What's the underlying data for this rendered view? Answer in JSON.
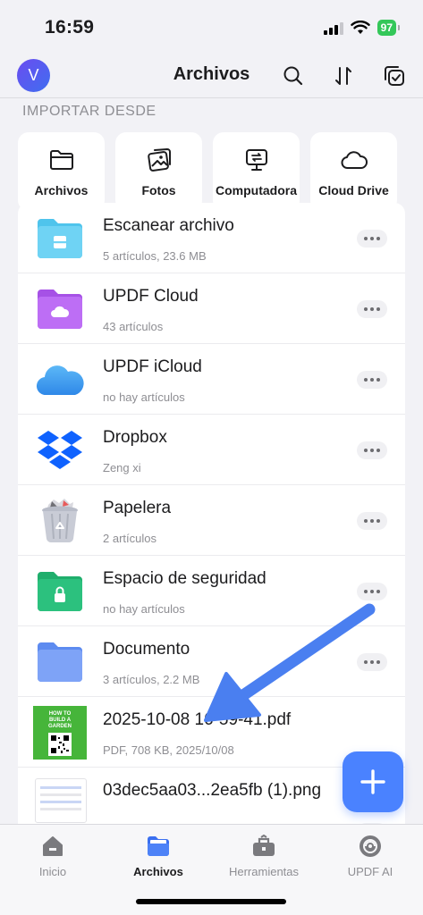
{
  "status_bar": {
    "time": "16:59",
    "battery": "97"
  },
  "nav": {
    "avatar_letter": "V",
    "title": "Archivos"
  },
  "import": {
    "section_title": "IMPORTAR DESDE",
    "items": [
      {
        "label": "Archivos",
        "icon": "folder-icon"
      },
      {
        "label": "Fotos",
        "icon": "photos-icon"
      },
      {
        "label": "Computadora",
        "icon": "computer-icon"
      },
      {
        "label": "Cloud Drive",
        "icon": "cloud-icon"
      }
    ]
  },
  "files": [
    {
      "name": "Escanear archivo",
      "meta": "5 artículos, 23.6 MB",
      "icon": "scan-folder-icon"
    },
    {
      "name": "UPDF Cloud",
      "meta": "43 artículos",
      "icon": "updf-cloud-folder-icon"
    },
    {
      "name": "UPDF iCloud",
      "meta": "no hay artículos",
      "icon": "icloud-icon"
    },
    {
      "name": "Dropbox",
      "meta": "Zeng xi",
      "icon": "dropbox-icon"
    },
    {
      "name": "Papelera",
      "meta": "2 artículos",
      "icon": "trash-icon"
    },
    {
      "name": "Espacio de seguridad",
      "meta": "no hay artículos",
      "icon": "secure-folder-icon"
    },
    {
      "name": "Documento",
      "meta": "3 artículos, 2.2 MB",
      "icon": "document-folder-icon"
    },
    {
      "name": "2025-10-08 16-59-41.pdf",
      "meta": "PDF, 708 KB, 2025/10/08",
      "icon": "pdf-thumbnail",
      "thumb_text": [
        "HOW TO",
        "BUILD A",
        "GARDEN"
      ]
    },
    {
      "name": "03dec5aa03...2ea5fb (1).png",
      "meta": "",
      "icon": "png-thumbnail"
    }
  ],
  "tabs": [
    {
      "label": "Inicio",
      "icon": "home-icon",
      "active": false
    },
    {
      "label": "Archivos",
      "icon": "files-icon",
      "active": true
    },
    {
      "label": "Herramientas",
      "icon": "tools-icon",
      "active": false
    },
    {
      "label": "UPDF AI",
      "icon": "ai-icon",
      "active": false
    }
  ],
  "colors": {
    "accent": "#4a82ff",
    "battery": "#34c759",
    "arrow": "#4a7ff0"
  }
}
